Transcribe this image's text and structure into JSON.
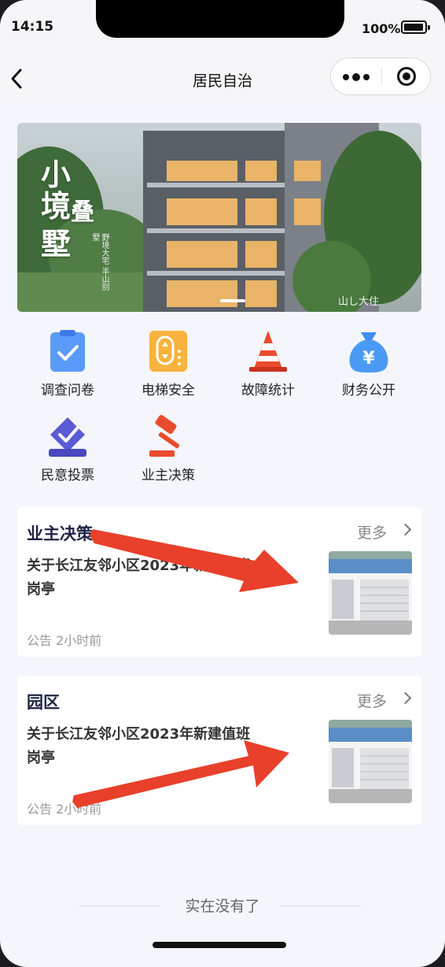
{
  "status_bar": {
    "time": "14:15",
    "battery": "100%"
  },
  "nav": {
    "title": "居民自治"
  },
  "banner": {
    "headline_line1": "小",
    "headline_line2": "境",
    "headline_line3": "叠",
    "headline_line4": "墅",
    "subtitle": "野境大宅 半山别墅",
    "logo": "山し大住"
  },
  "grid": [
    {
      "label": "调查问卷",
      "icon": "clipboard-check-icon",
      "color": "#4a8cf7"
    },
    {
      "label": "电梯安全",
      "icon": "elevator-icon",
      "color": "#f5a623"
    },
    {
      "label": "故障统计",
      "icon": "traffic-cone-icon",
      "color": "#e8402a"
    },
    {
      "label": "财务公开",
      "icon": "money-bag-icon",
      "color": "#3d8ef0"
    },
    {
      "label": "民意投票",
      "icon": "ballot-box-icon",
      "color": "#5b5bd6"
    },
    {
      "label": "业主决策",
      "icon": "gavel-icon",
      "color": "#e8402a"
    }
  ],
  "cards": [
    {
      "title": "业主决策",
      "more": "更多",
      "text": "关于长江友邻小区2023年新建值班岗亭",
      "meta": "公告 2小时前"
    },
    {
      "title": "园区",
      "more": "更多",
      "text": "关于长江友邻小区2023年新建值班岗亭",
      "meta": "公告 2小时前"
    }
  ],
  "footer": {
    "text": "实在没有了"
  },
  "colors": {
    "annotation_arrow": "#e8402a",
    "title_navy": "#1e2344"
  }
}
